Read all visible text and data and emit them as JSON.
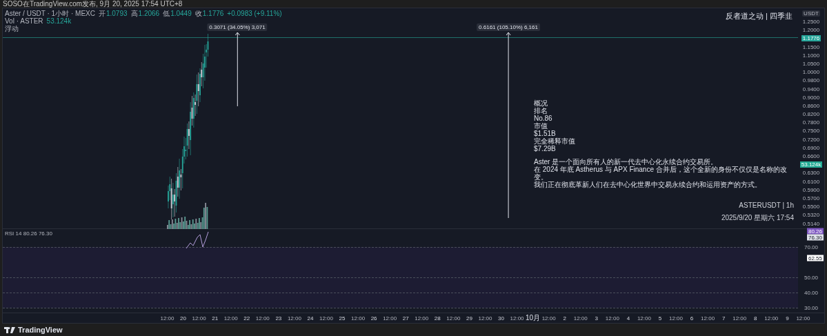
{
  "header": {
    "text": "SOSO在TradingView.com发布, 9月 20, 2025 17:54 UTC+8"
  },
  "legend": {
    "symbol": "Aster / USDT · 1小时 · MEXC",
    "ohlc": [
      {
        "label": "开",
        "value": "1.0793"
      },
      {
        "label": "高",
        "value": "1.2066"
      },
      {
        "label": "低",
        "value": "1.0449"
      },
      {
        "label": "收",
        "value": "1.1776"
      }
    ],
    "change": "+0.0983 (+9.11%)",
    "volume_label": "Vol · ASTER",
    "volume_value": "53.124k",
    "extra": "浮动"
  },
  "signature": "反者道之动 | 四季韭",
  "measurements": [
    {
      "label": "0.3071 (34.05%) 3,071"
    },
    {
      "label": "0.6161 (105.10%) 6,161"
    }
  ],
  "price_axis": {
    "unit": "USDT",
    "ticks": [
      "1.2500",
      "1.2000",
      "1.1500",
      "1.1000",
      "1.0500",
      "1.0000",
      "0.9800",
      "0.9400",
      "0.9000",
      "0.8600",
      "0.8200",
      "0.7800",
      "0.7500",
      "0.7200",
      "0.6900",
      "0.6600",
      "0.6300",
      "0.6100",
      "0.5900",
      "0.5700",
      "0.5500",
      "0.5320",
      "0.5140"
    ],
    "last_price": "1.1776",
    "volume_badge": "53.124k"
  },
  "info": {
    "lines": [
      "概况",
      "排名",
      "No.86",
      "市值",
      "$1.51B",
      "完全稀释市值",
      "$7.29B"
    ],
    "paragraph": [
      "Aster 是一个面向所有人的新一代去中心化永续合约交易所。",
      "在 2024 年底 Astherus 与 APX Finance 合并后，这个全新的身份不仅仅是名称的改变。",
      "我们正在彻底革新人们在去中心化世界中交易永续合约和运用资产的方式。"
    ]
  },
  "symbol_caption": "ASTERUSDT | 1h",
  "datetime": "2025/9/20 星期六 17:54",
  "rsi": {
    "legend": "RSI 14 80.26 76.30",
    "ticks": [
      "70.00",
      "50.00",
      "40.00",
      "30.00"
    ],
    "badges": [
      {
        "label": "80.26",
        "color": "#7e57c2"
      },
      {
        "label": "76.30",
        "color": "#e0e3eb"
      },
      {
        "label": "62.55",
        "color": "#ffffff"
      }
    ]
  },
  "time_axis": [
    {
      "label": "12:00",
      "kind": "time"
    },
    {
      "label": "20",
      "kind": "day"
    },
    {
      "label": "12:00",
      "kind": "time"
    },
    {
      "label": "21",
      "kind": "day"
    },
    {
      "label": "12:00",
      "kind": "time"
    },
    {
      "label": "22",
      "kind": "day"
    },
    {
      "label": "12:00",
      "kind": "time"
    },
    {
      "label": "23",
      "kind": "day"
    },
    {
      "label": "12:00",
      "kind": "time"
    },
    {
      "label": "24",
      "kind": "day"
    },
    {
      "label": "12:00",
      "kind": "time"
    },
    {
      "label": "25",
      "kind": "day"
    },
    {
      "label": "12:00",
      "kind": "time"
    },
    {
      "label": "26",
      "kind": "day"
    },
    {
      "label": "12:00",
      "kind": "time"
    },
    {
      "label": "27",
      "kind": "day"
    },
    {
      "label": "12:00",
      "kind": "time"
    },
    {
      "label": "28",
      "kind": "day"
    },
    {
      "label": "12:00",
      "kind": "time"
    },
    {
      "label": "29",
      "kind": "day"
    },
    {
      "label": "12:00",
      "kind": "time"
    },
    {
      "label": "30",
      "kind": "day"
    },
    {
      "label": "12:00",
      "kind": "time"
    },
    {
      "label": "10月",
      "kind": "month"
    },
    {
      "label": "12:00",
      "kind": "time"
    },
    {
      "label": "2",
      "kind": "day"
    },
    {
      "label": "12:00",
      "kind": "time"
    },
    {
      "label": "3",
      "kind": "day"
    },
    {
      "label": "12:00",
      "kind": "time"
    },
    {
      "label": "4",
      "kind": "day"
    },
    {
      "label": "12:00",
      "kind": "time"
    },
    {
      "label": "5",
      "kind": "day"
    },
    {
      "label": "12:00",
      "kind": "time"
    },
    {
      "label": "6",
      "kind": "day"
    },
    {
      "label": "12:00",
      "kind": "time"
    },
    {
      "label": "7",
      "kind": "day"
    },
    {
      "label": "12:00",
      "kind": "time"
    },
    {
      "label": "8",
      "kind": "day"
    },
    {
      "label": "12:00",
      "kind": "time"
    },
    {
      "label": "9",
      "kind": "day"
    },
    {
      "label": "12:00",
      "kind": "time"
    }
  ],
  "brand": "TradingView"
}
